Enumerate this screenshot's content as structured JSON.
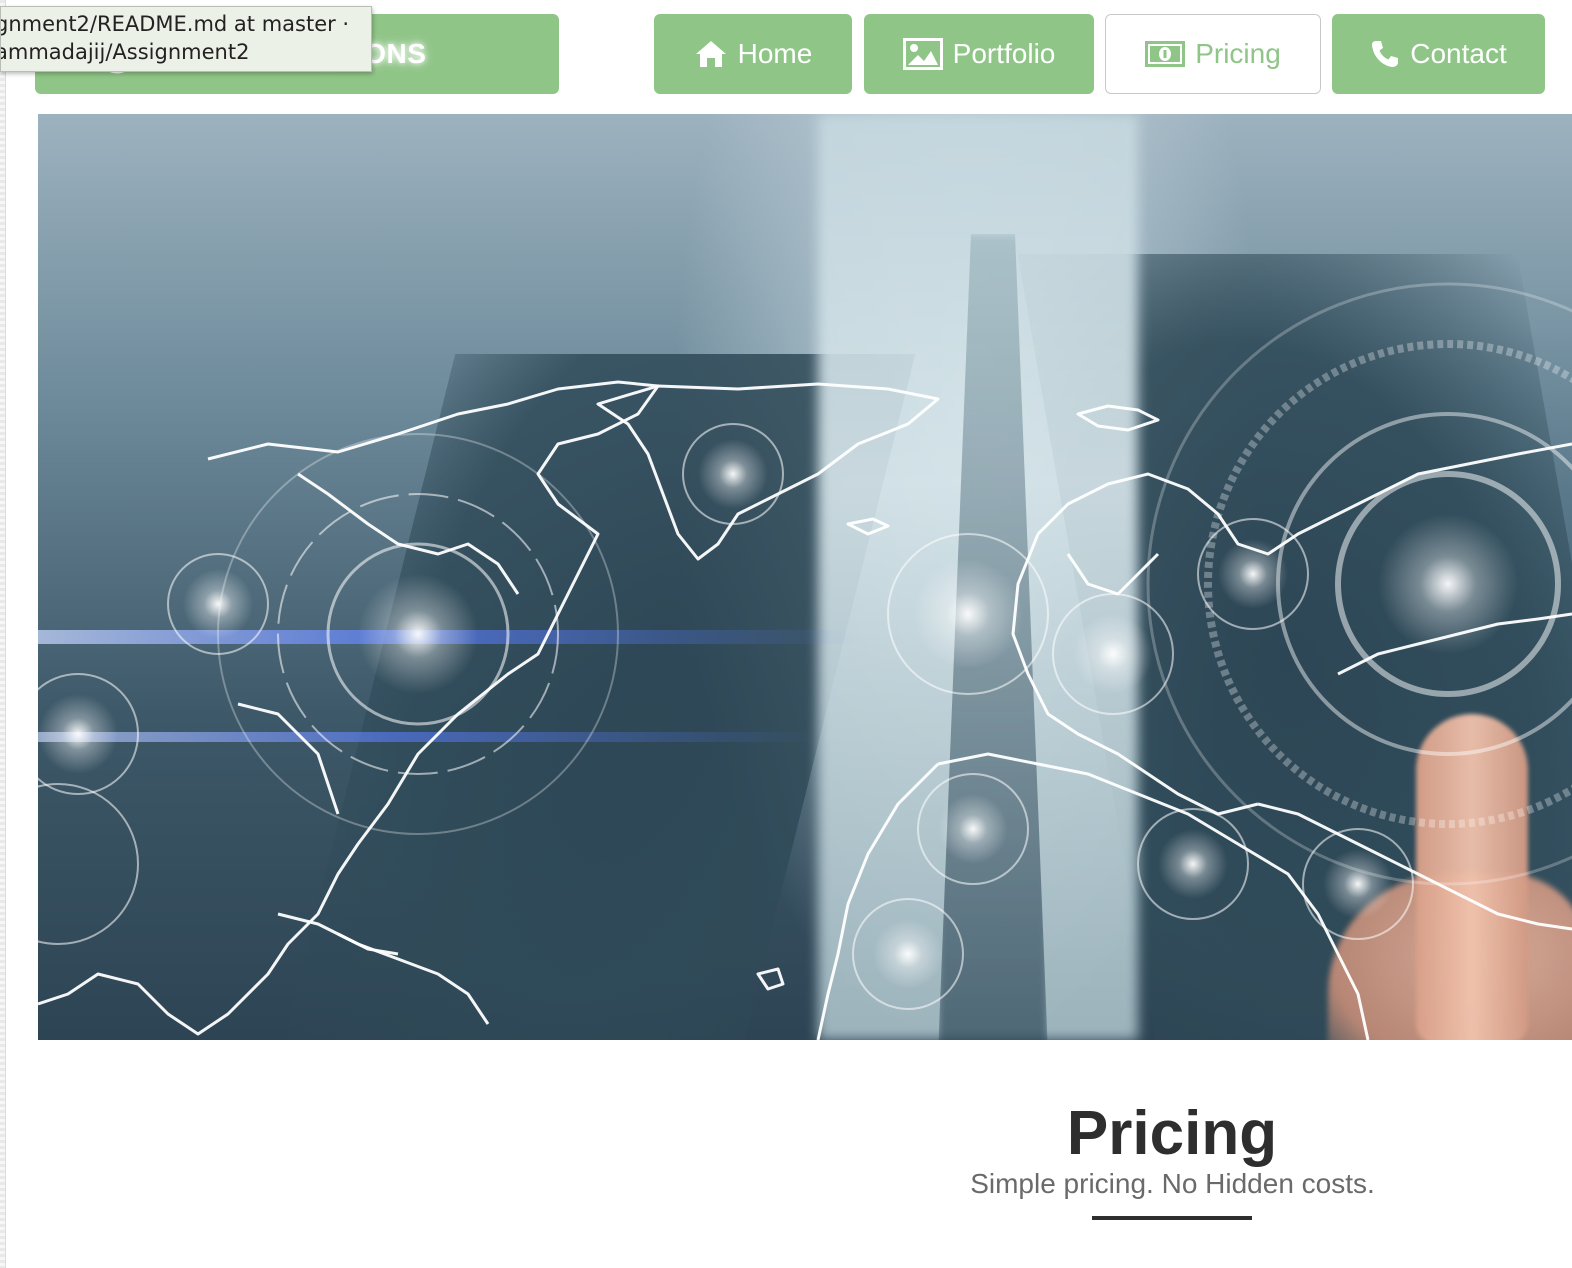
{
  "tooltip": {
    "line1": "gnment2/README.md at master ·",
    "line2": "ammadajij/Assignment2"
  },
  "brand": {
    "text_visible": "UTIONS",
    "logo_icon": "globe-hands-icon"
  },
  "nav": {
    "items": [
      {
        "label": "Home",
        "icon": "home-icon",
        "active": false
      },
      {
        "label": "Portfolio",
        "icon": "image-icon",
        "active": false
      },
      {
        "label": "Pricing",
        "icon": "money-icon",
        "active": true
      },
      {
        "label": "Contact",
        "icon": "phone-icon",
        "active": false
      }
    ]
  },
  "hero": {
    "image_description_icon": "world-map-touch-hero-image"
  },
  "pricing_section": {
    "title": "Pricing",
    "subtitle": "Simple pricing. No Hidden costs."
  },
  "colors": {
    "accent_green": "#8fc587",
    "heading": "#2e2e2e",
    "subtext": "#6a6a6a"
  }
}
